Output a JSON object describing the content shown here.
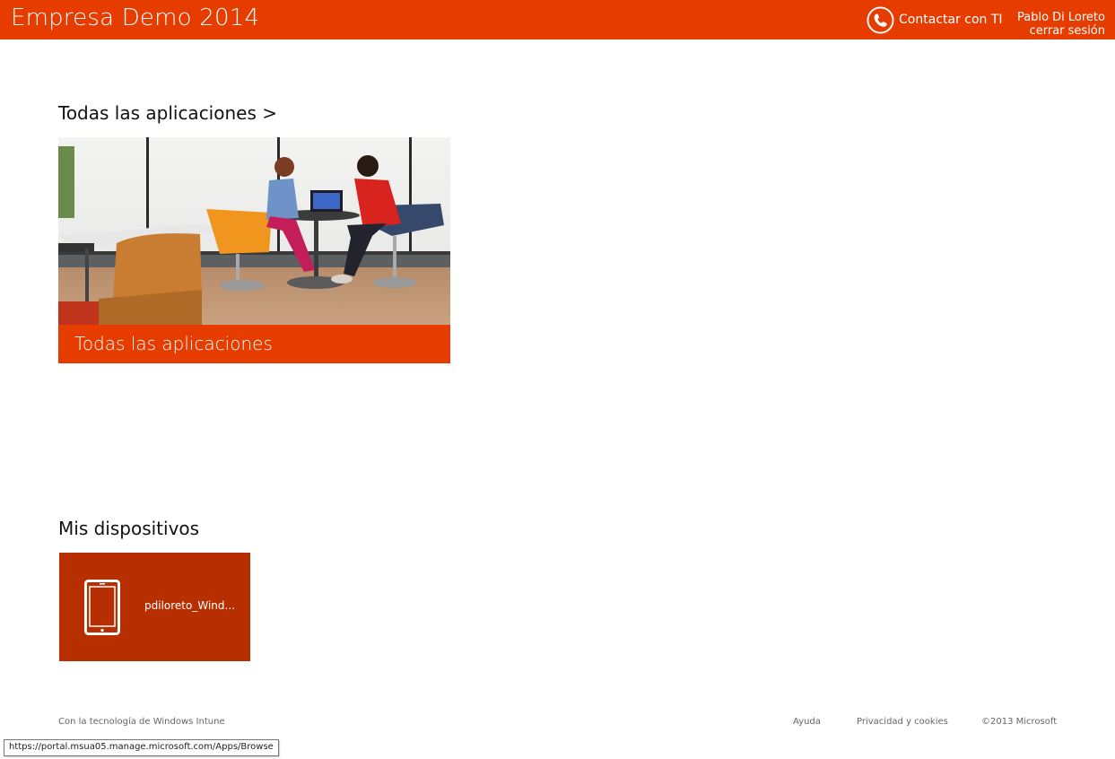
{
  "header": {
    "brand": "Empresa Demo 2014",
    "contact_label": "Contactar con TI",
    "contact_icon": "phone-icon",
    "user_name": "Pablo Di Loreto",
    "signout_label": "cerrar sesión",
    "bg_color": "#e63c00"
  },
  "apps_section": {
    "title": "Todas las aplicaciones >",
    "tile_caption": "Todas las aplicaciones"
  },
  "devices_section": {
    "title": "Mis dispositivos",
    "device_name": "pdiloreto_Wind...",
    "device_icon": "tablet-icon",
    "tile_color": "#b72f00"
  },
  "footer": {
    "powered_by": "Con la tecnología de Windows Intune",
    "help": "Ayuda",
    "privacy": "Privacidad y cookies",
    "copyright": "©2013 Microsoft"
  },
  "status_bar": {
    "url": "https://portal.msua05.manage.microsoft.com/Apps/Browse"
  }
}
